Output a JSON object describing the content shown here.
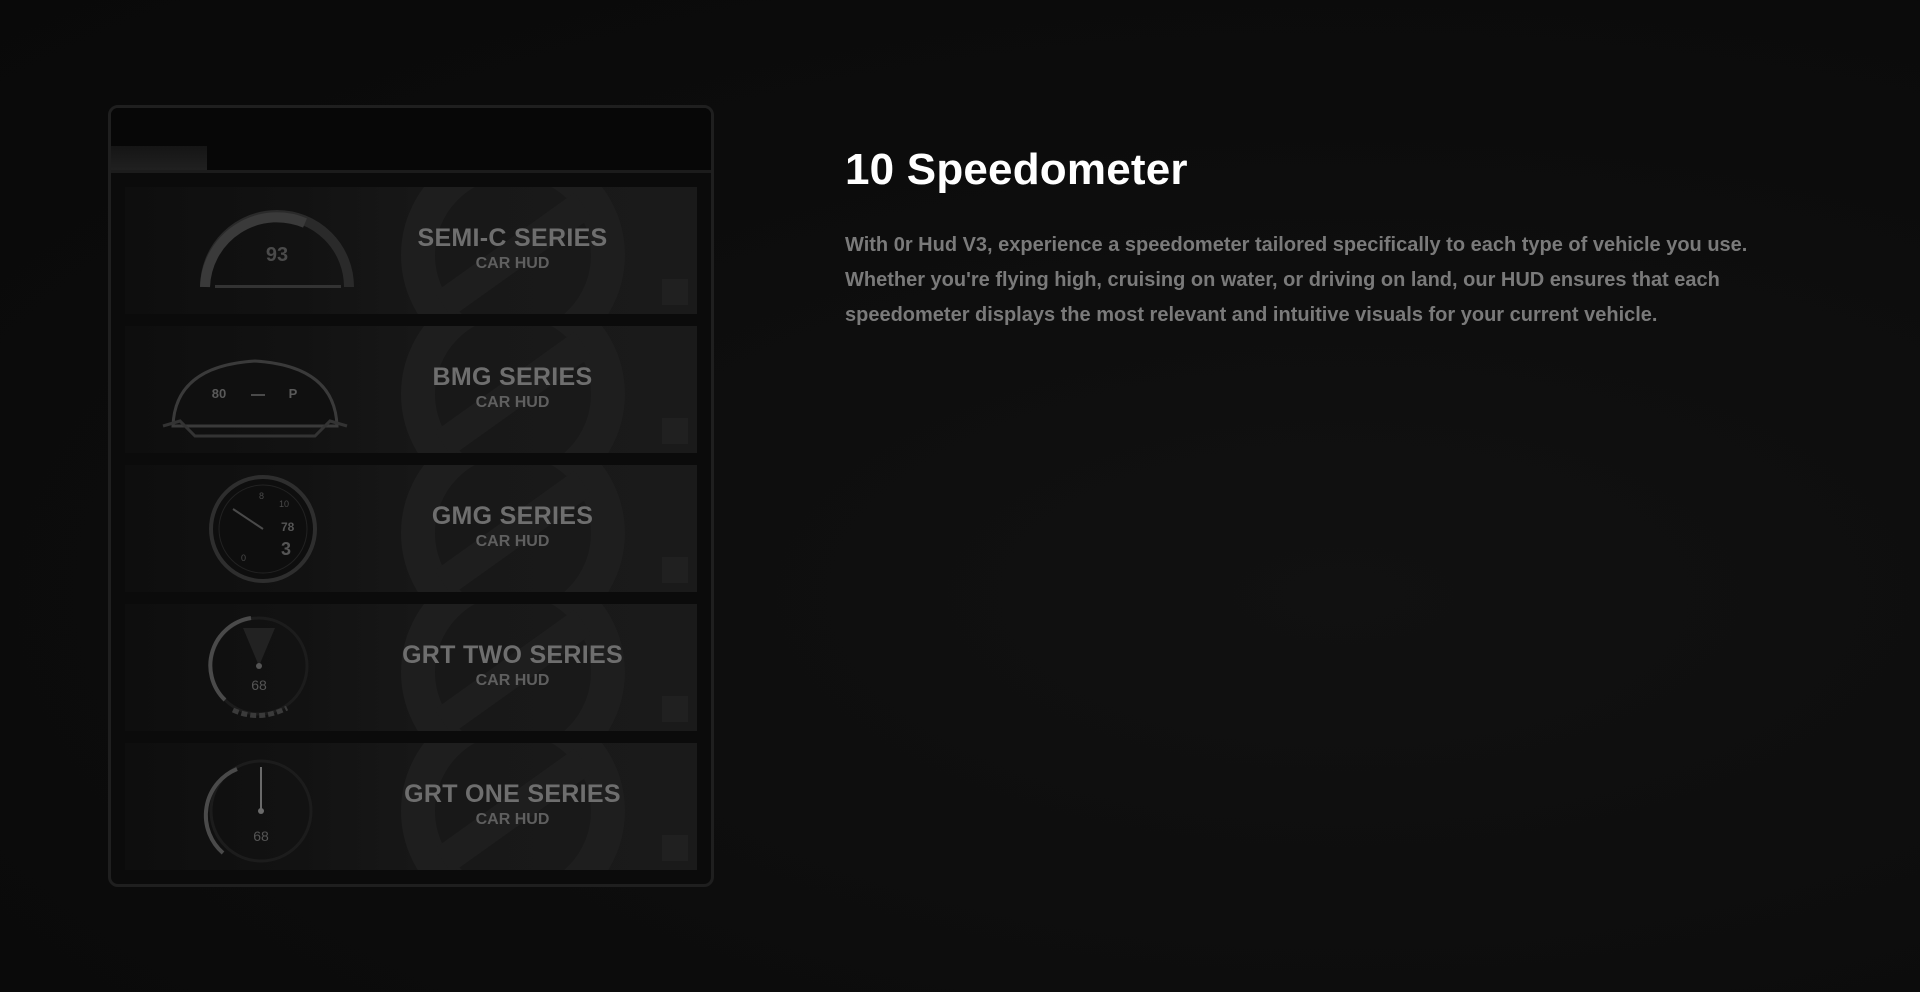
{
  "selector": {
    "cards": [
      {
        "title": "SEMI-C SERIES",
        "subtitle": "CAR HUD",
        "gauge_value": "93",
        "gauge_type": "semi-circle-gauge"
      },
      {
        "title": "BMG SERIES",
        "subtitle": "CAR HUD",
        "gauge_value": "80",
        "gauge_gear": "P",
        "gauge_type": "dashboard-cluster"
      },
      {
        "title": "GMG SERIES",
        "subtitle": "CAR HUD",
        "gauge_value": "78",
        "gauge_gear": "3",
        "gauge_type": "tachometer-dial"
      },
      {
        "title": "GRT TWO SERIES",
        "subtitle": "CAR HUD",
        "gauge_value": "68",
        "gauge_type": "radial-sweep-gauge"
      },
      {
        "title": "GRT ONE SERIES",
        "subtitle": "CAR HUD",
        "gauge_value": "68",
        "gauge_type": "needle-gauge"
      }
    ]
  },
  "feature": {
    "title": "10 Speedometer",
    "description": "With 0r Hud V3, experience a speedometer tailored specifically to each type of vehicle you use. Whether you're flying high, cruising on water, or driving on land, our HUD ensures that each speedometer displays the most relevant and intuitive visuals for your current vehicle."
  },
  "colors": {
    "background": "#0d0d0d",
    "heading": "#ffffff",
    "body_text": "#7a7a7a",
    "card_text": "#6e6e6e"
  }
}
